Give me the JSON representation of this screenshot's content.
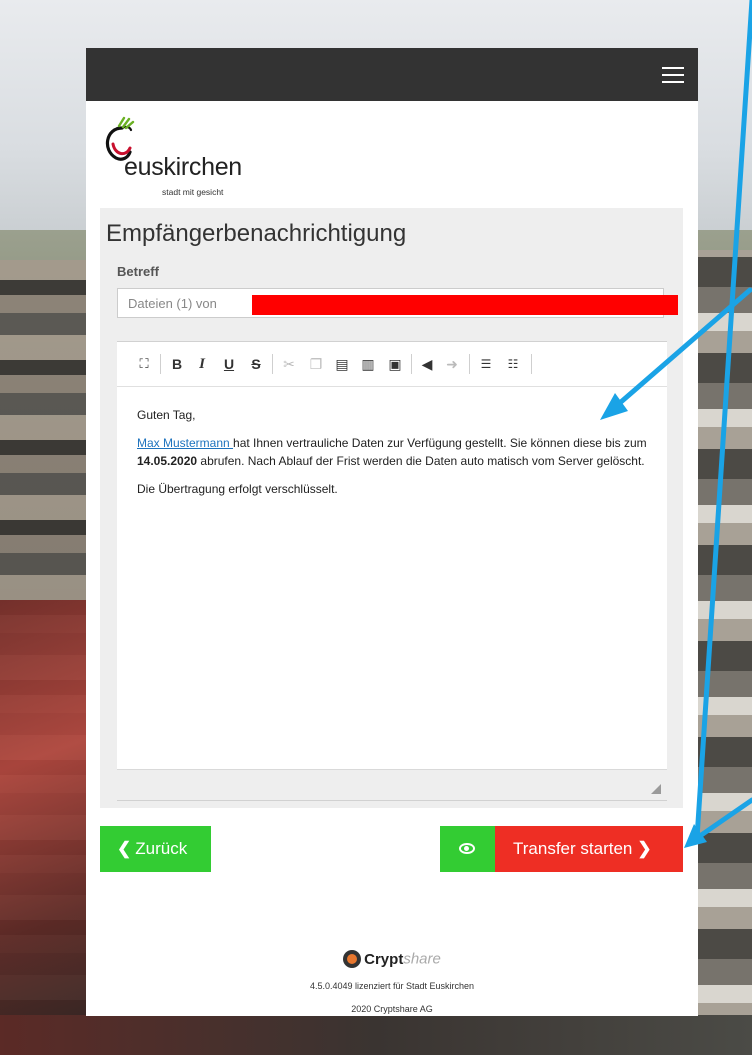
{
  "logo": {
    "wordmark": "euskirchen",
    "tagline": "stadt mit gesicht"
  },
  "panel": {
    "title": "Empfängerbenachrichtigung",
    "subject_label": "Betreff",
    "subject_value": "Dateien (1) von"
  },
  "toolbar": {
    "icons": [
      "maximize-icon",
      "bold-icon",
      "italic-icon",
      "underline-icon",
      "strikethrough-icon",
      "cut-icon",
      "copy-icon",
      "paste-icon",
      "paste-text-icon",
      "paste-word-icon",
      "undo-icon",
      "redo-icon",
      "numbered-list-icon",
      "bulleted-list-icon"
    ],
    "bold": "B",
    "italic": "I",
    "underline": "U",
    "strike": "S"
  },
  "message": {
    "greeting": "Guten Tag,",
    "sender_link": "Max Mustermann ",
    "body_1": "hat Ihnen vertrauliche Daten zur Verfügung gestellt. Sie können diese bis zum ",
    "date": "14.05.2020",
    "body_2": " abrufen. Nach Ablauf der Frist werden die Daten auto matisch vom Server gelöscht.",
    "closing": "Die Übertragung erfolgt verschlüsselt."
  },
  "buttons": {
    "back": "Zurück",
    "back_icon": "chevron-left-icon",
    "preview_icon": "eye-icon",
    "transfer": "Transfer starten",
    "transfer_icon": "chevron-right-icon"
  },
  "footer": {
    "brand_bold": "Crypt",
    "brand_italic": "share",
    "version": "4.5.0.4049 lizenziert für Stadt Euskirchen",
    "copyright": "2020 Cryptshare AG"
  },
  "colors": {
    "topbar": "#333333",
    "green": "#33cc33",
    "red": "#ee2e24",
    "link": "#1e73be",
    "annotation_arrow": "#1aa3e6",
    "redaction": "#ff0000"
  }
}
